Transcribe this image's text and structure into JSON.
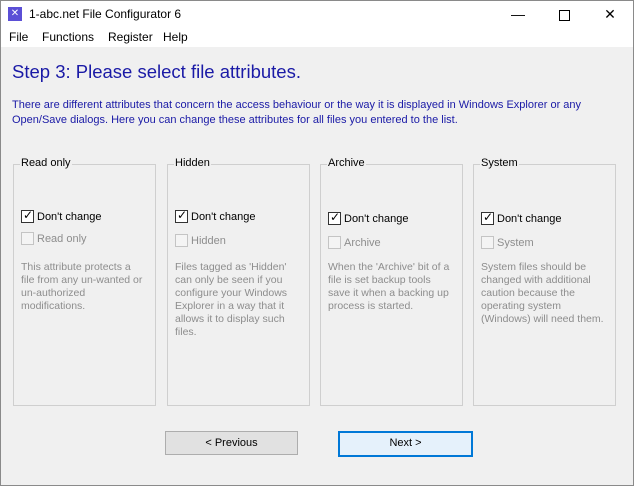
{
  "window": {
    "title": "1-abc.net File Configurator 6",
    "icon": "tools-icon",
    "controls": {
      "minimize": "—",
      "close": "✕"
    }
  },
  "menu": [
    "File",
    "Functions",
    "Register",
    "Help"
  ],
  "step": {
    "title": "Step 3: Please select file attributes.",
    "description": "There are different attributes that concern the access behaviour or the way it is displayed in Windows Explorer or any Open/Save dialogs. Here you can change these attributes for all files you entered to the list."
  },
  "groups": [
    {
      "legend": "Read only",
      "dont_change": {
        "label": "Don't change",
        "checked": true
      },
      "attribute": {
        "label": "Read only",
        "checked": false,
        "enabled": false
      },
      "note": "This attribute protects a file from any un-wanted or un-authorized modifications."
    },
    {
      "legend": "Hidden",
      "dont_change": {
        "label": "Don't change",
        "checked": true
      },
      "attribute": {
        "label": "Hidden",
        "checked": false,
        "enabled": false
      },
      "note": "Files tagged as 'Hidden' can only be seen if you configure your Windows Explorer in a way that it allows it to display such files."
    },
    {
      "legend": "Archive",
      "dont_change": {
        "label": "Don't change",
        "checked": true
      },
      "attribute": {
        "label": "Archive",
        "checked": false,
        "enabled": false
      },
      "note": "When the 'Archive' bit of a file is set backup tools save it when a backing up process is started."
    },
    {
      "legend": "System",
      "dont_change": {
        "label": "Don't change",
        "checked": true
      },
      "attribute": {
        "label": "System",
        "checked": false,
        "enabled": false
      },
      "note": "System files should be changed with additional caution because the operating system (Windows) will need them."
    }
  ],
  "buttons": {
    "previous": "< Previous",
    "next": "Next >"
  },
  "colors": {
    "heading": "#1a1aa6",
    "disabled_text": "#8d8d8d",
    "focus_border": "#0078d7"
  }
}
